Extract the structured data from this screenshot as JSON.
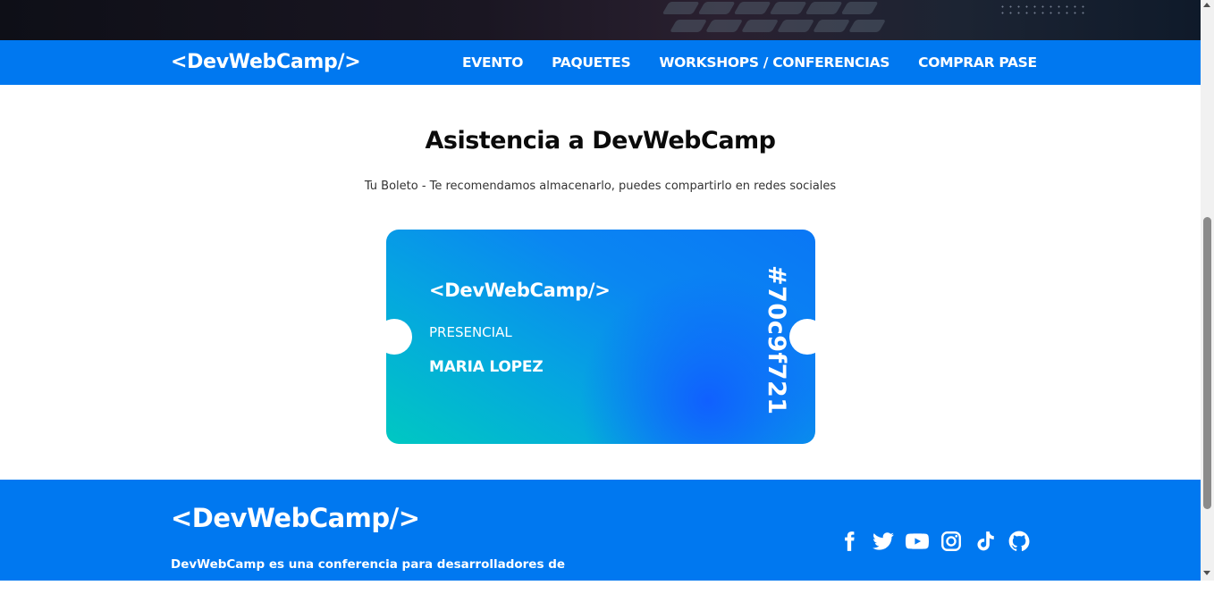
{
  "header": {
    "logo": "<DevWebCamp/>",
    "nav": [
      "EVENTO",
      "PAQUETES",
      "WORKSHOPS / CONFERENCIAS",
      "COMPRAR PASE"
    ]
  },
  "main": {
    "title": "Asistencia a DevWebCamp",
    "subtitle": "Tu Boleto - Te recomendamos almacenarlo, puedes compartirlo en redes sociales",
    "ticket": {
      "logo": "<DevWebCamp/>",
      "type": "PRESENCIAL",
      "name": "MARIA LOPEZ",
      "code": "#70c9f721"
    }
  },
  "footer": {
    "logo": "<DevWebCamp/>",
    "description": "DevWebCamp es una conferencia para desarrolladores de todos los",
    "socials": [
      "facebook-icon",
      "twitter-icon",
      "youtube-icon",
      "instagram-icon",
      "tiktok-icon",
      "github-icon"
    ]
  },
  "colors": {
    "primary": "#0078f0",
    "ticket_start": "#00c8c2",
    "ticket_end": "#0a77f5",
    "text_dark": "#0b0b0b"
  }
}
